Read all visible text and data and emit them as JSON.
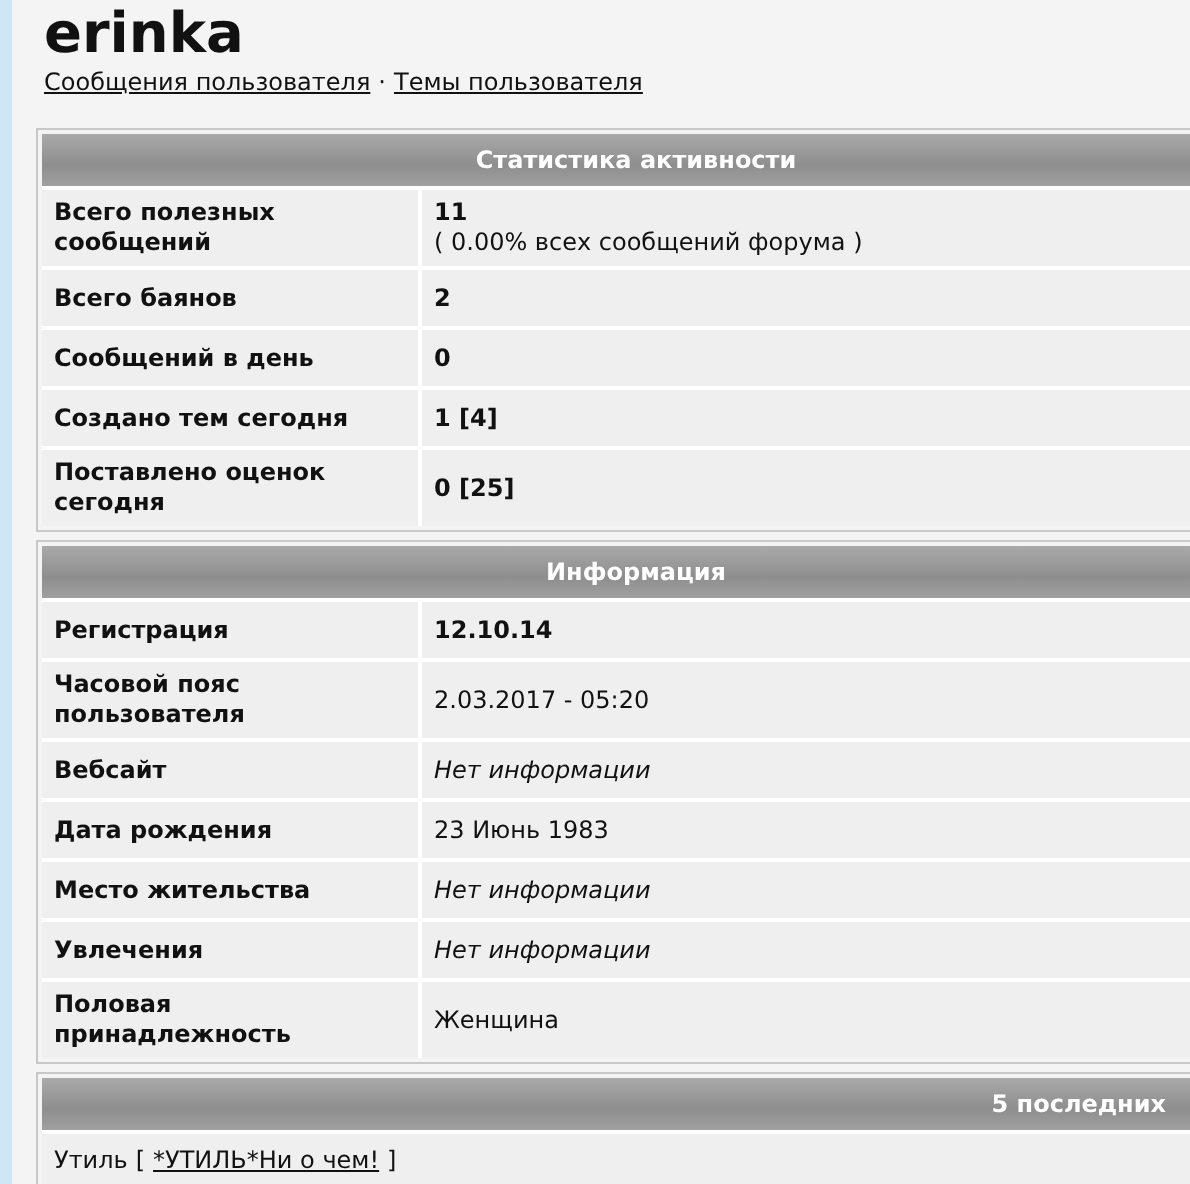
{
  "user": {
    "name": "erinka"
  },
  "links": [
    "Сообщения пользователя",
    "Темы пользователя"
  ],
  "link_separator": "·",
  "sections": [
    {
      "title": "Статистика активности",
      "rows": [
        {
          "label": "Всего полезных сообщений",
          "value": "11",
          "kind": "bold",
          "note": "( 0.00% всех сообщений форума )"
        },
        {
          "label": "Всего баянов",
          "value": "2",
          "kind": "bold"
        },
        {
          "label": "Сообщений в день",
          "value": "0",
          "kind": "bold"
        },
        {
          "label": "Создано тем сегодня",
          "value": "1 [4]",
          "kind": "bold"
        },
        {
          "label": "Поставлено оценок сегодня",
          "value": "0 [25]",
          "kind": "bold"
        }
      ]
    },
    {
      "title": "Информация",
      "rows": [
        {
          "label": "Регистрация",
          "value": "12.10.14",
          "kind": "bold"
        },
        {
          "label": "Часовой пояс пользователя",
          "value": "2.03.2017 - 05:20",
          "kind": "plain"
        },
        {
          "label": "Вебсайт",
          "value": "Нет информации",
          "kind": "italic"
        },
        {
          "label": "Дата рождения",
          "value": "23 Июнь 1983",
          "kind": "plain"
        },
        {
          "label": "Место жительства",
          "value": "Нет информации",
          "kind": "italic"
        },
        {
          "label": "Увлечения",
          "value": "Нет информации",
          "kind": "italic"
        },
        {
          "label": "Половая принадлежность",
          "value": "Женщина",
          "kind": "plain"
        }
      ]
    }
  ],
  "recent": {
    "title": "5 последних",
    "items": [
      {
        "forum": "Утиль",
        "open": "[",
        "topic": "*УТИЛЬ*Ни о чем!",
        "close": "]"
      }
    ]
  }
}
